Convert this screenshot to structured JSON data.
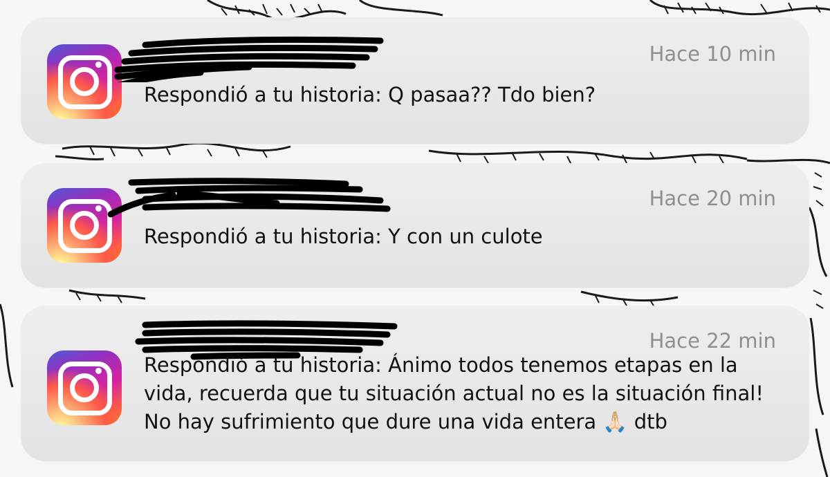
{
  "notifications": [
    {
      "app_icon": "instagram-icon",
      "time": "Hace 10 min",
      "message": "Respondió a tu historia: Q pasaa?? Tdo bien?"
    },
    {
      "app_icon": "instagram-icon",
      "time": "Hace 20 min",
      "message": "Respondió a tu historia: Y con un culote"
    },
    {
      "app_icon": "instagram-icon",
      "time": "Hace 22 min",
      "message": "Respondió a tu historia: Ánimo todos tenemos etapas en la vida, recuerda que tu situación actual no es la situación final! No hay sufrimiento que dure una vida entera",
      "emoji": "🙏🏻",
      "suffix": " dtb"
    }
  ],
  "colors": {
    "card": "#e9e9e9",
    "time_text": "#8e8e93",
    "body_text": "#111111",
    "redaction": "#000000"
  }
}
